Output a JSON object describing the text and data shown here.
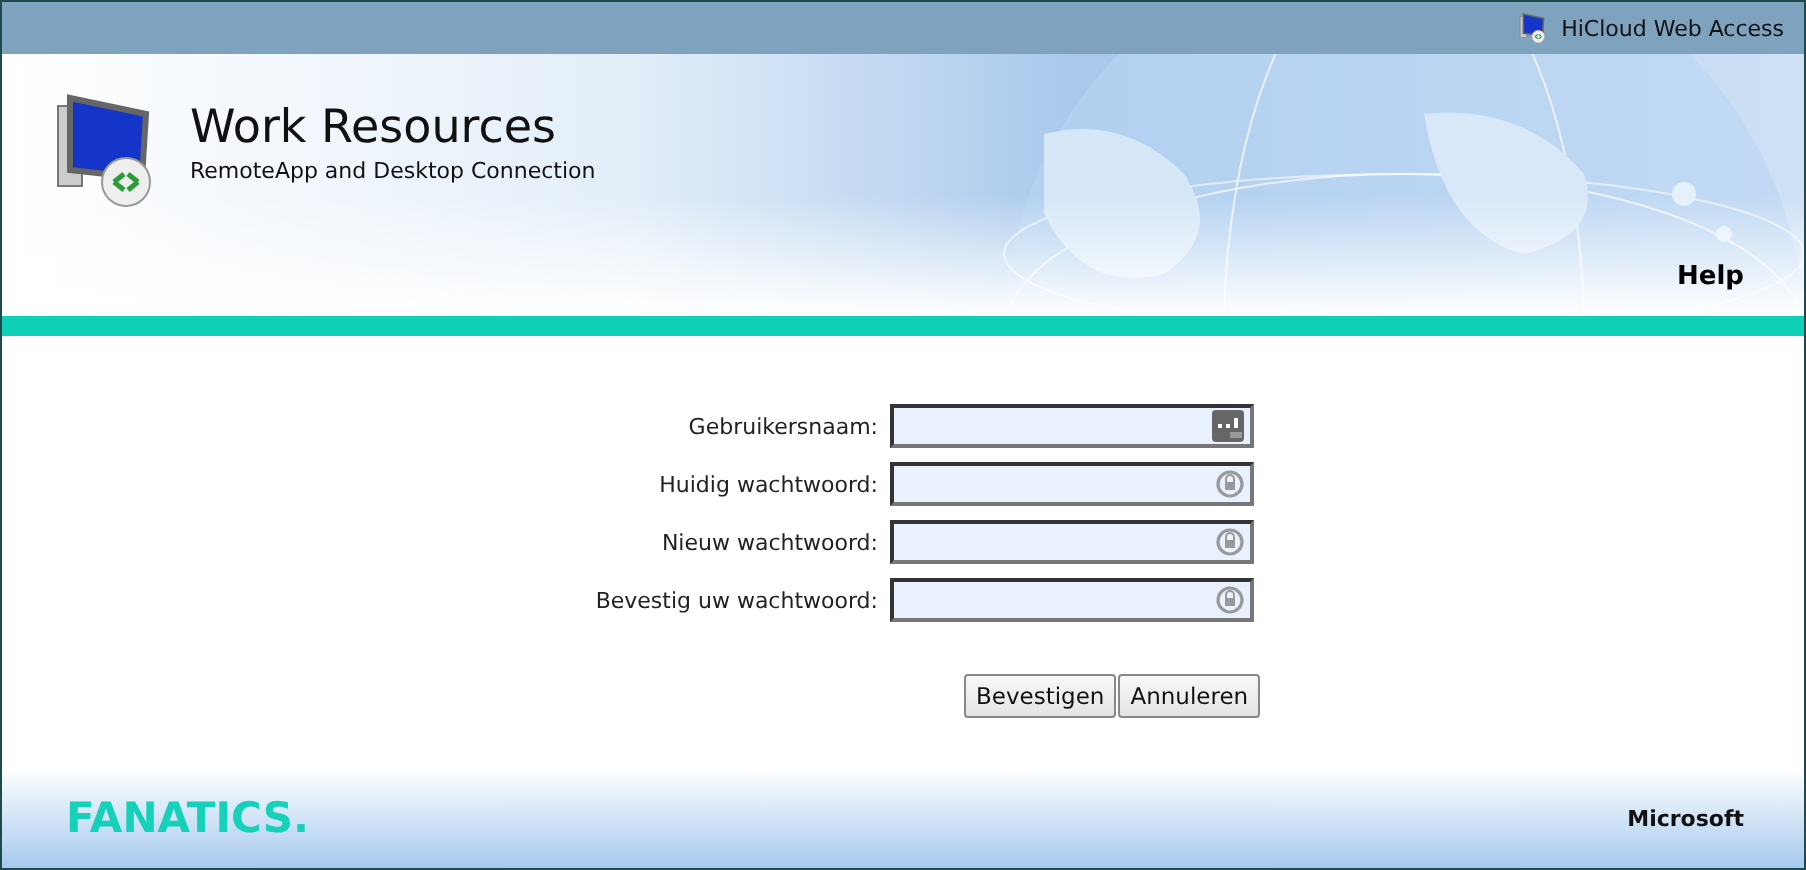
{
  "top_bar": {
    "title": "HiCloud Web Access"
  },
  "header": {
    "title": "Work Resources",
    "subtitle": "RemoteApp and Desktop Connection",
    "help_link": "Help"
  },
  "form": {
    "fields": [
      {
        "label": "Gebruikersnaam:",
        "kind": "text"
      },
      {
        "label": "Huidig wachtwoord:",
        "kind": "password"
      },
      {
        "label": "Nieuw wachtwoord:",
        "kind": "password"
      },
      {
        "label": "Bevestig uw wachtwoord:",
        "kind": "password"
      }
    ],
    "buttons": [
      "Bevestigen",
      "Annuleren"
    ]
  },
  "footer": {
    "brand": "FANATICS.",
    "vendor": "Microsoft"
  }
}
